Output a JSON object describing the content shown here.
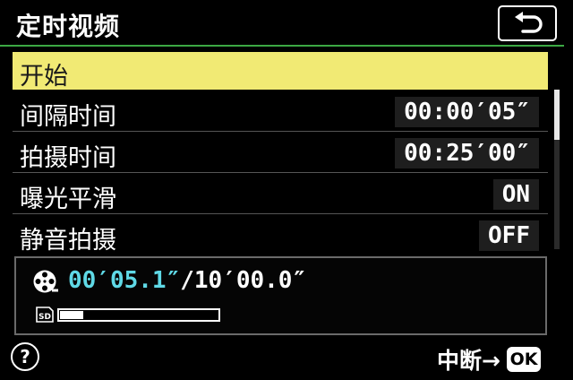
{
  "header": {
    "title": "定时视频",
    "back_icon": "return-arrow-icon"
  },
  "menu": {
    "items": [
      {
        "label": "开始",
        "value": null,
        "selected": true
      },
      {
        "label": "间隔时间",
        "value": "00:00′05″"
      },
      {
        "label": "拍摄时间",
        "value": "00:25′00″"
      },
      {
        "label": "曝光平滑",
        "value": "ON"
      },
      {
        "label": "静音拍摄",
        "value": "OFF"
      }
    ]
  },
  "info": {
    "movie_icon": "film-reel-icon",
    "card_icon": "sd-card-icon",
    "current_time": "00′05.1″",
    "separator": "/",
    "total_time": "10′00.0″",
    "progress_fraction": 0.15,
    "accent_color": "#5fd9e6"
  },
  "footer": {
    "help_icon": "help-icon",
    "help_glyph": "?",
    "hint_label": "中断→",
    "ok_label": "OK"
  },
  "colors": {
    "selection": "#f1ea74",
    "title_underline": "#3ca844"
  }
}
